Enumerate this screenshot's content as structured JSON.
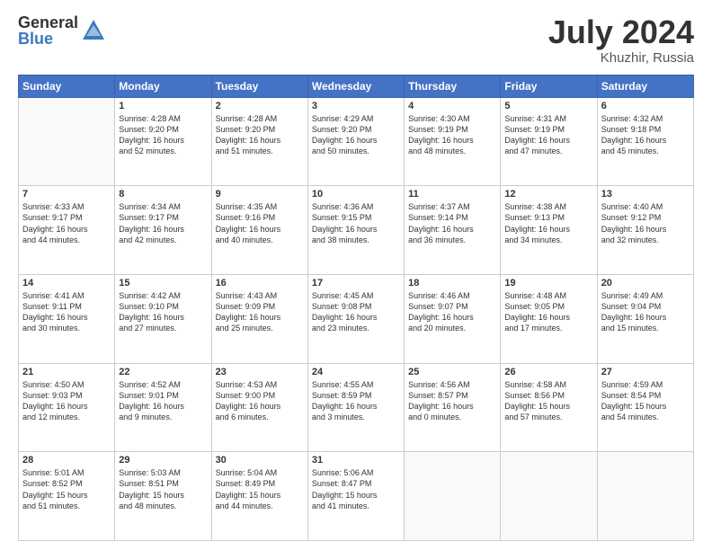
{
  "header": {
    "logo_general": "General",
    "logo_blue": "Blue",
    "title": "July 2024",
    "location": "Khuzhir, Russia"
  },
  "days_of_week": [
    "Sunday",
    "Monday",
    "Tuesday",
    "Wednesday",
    "Thursday",
    "Friday",
    "Saturday"
  ],
  "weeks": [
    [
      {
        "day": "",
        "info": ""
      },
      {
        "day": "1",
        "info": "Sunrise: 4:28 AM\nSunset: 9:20 PM\nDaylight: 16 hours\nand 52 minutes."
      },
      {
        "day": "2",
        "info": "Sunrise: 4:28 AM\nSunset: 9:20 PM\nDaylight: 16 hours\nand 51 minutes."
      },
      {
        "day": "3",
        "info": "Sunrise: 4:29 AM\nSunset: 9:20 PM\nDaylight: 16 hours\nand 50 minutes."
      },
      {
        "day": "4",
        "info": "Sunrise: 4:30 AM\nSunset: 9:19 PM\nDaylight: 16 hours\nand 48 minutes."
      },
      {
        "day": "5",
        "info": "Sunrise: 4:31 AM\nSunset: 9:19 PM\nDaylight: 16 hours\nand 47 minutes."
      },
      {
        "day": "6",
        "info": "Sunrise: 4:32 AM\nSunset: 9:18 PM\nDaylight: 16 hours\nand 45 minutes."
      }
    ],
    [
      {
        "day": "7",
        "info": "Sunrise: 4:33 AM\nSunset: 9:17 PM\nDaylight: 16 hours\nand 44 minutes."
      },
      {
        "day": "8",
        "info": "Sunrise: 4:34 AM\nSunset: 9:17 PM\nDaylight: 16 hours\nand 42 minutes."
      },
      {
        "day": "9",
        "info": "Sunrise: 4:35 AM\nSunset: 9:16 PM\nDaylight: 16 hours\nand 40 minutes."
      },
      {
        "day": "10",
        "info": "Sunrise: 4:36 AM\nSunset: 9:15 PM\nDaylight: 16 hours\nand 38 minutes."
      },
      {
        "day": "11",
        "info": "Sunrise: 4:37 AM\nSunset: 9:14 PM\nDaylight: 16 hours\nand 36 minutes."
      },
      {
        "day": "12",
        "info": "Sunrise: 4:38 AM\nSunset: 9:13 PM\nDaylight: 16 hours\nand 34 minutes."
      },
      {
        "day": "13",
        "info": "Sunrise: 4:40 AM\nSunset: 9:12 PM\nDaylight: 16 hours\nand 32 minutes."
      }
    ],
    [
      {
        "day": "14",
        "info": "Sunrise: 4:41 AM\nSunset: 9:11 PM\nDaylight: 16 hours\nand 30 minutes."
      },
      {
        "day": "15",
        "info": "Sunrise: 4:42 AM\nSunset: 9:10 PM\nDaylight: 16 hours\nand 27 minutes."
      },
      {
        "day": "16",
        "info": "Sunrise: 4:43 AM\nSunset: 9:09 PM\nDaylight: 16 hours\nand 25 minutes."
      },
      {
        "day": "17",
        "info": "Sunrise: 4:45 AM\nSunset: 9:08 PM\nDaylight: 16 hours\nand 23 minutes."
      },
      {
        "day": "18",
        "info": "Sunrise: 4:46 AM\nSunset: 9:07 PM\nDaylight: 16 hours\nand 20 minutes."
      },
      {
        "day": "19",
        "info": "Sunrise: 4:48 AM\nSunset: 9:05 PM\nDaylight: 16 hours\nand 17 minutes."
      },
      {
        "day": "20",
        "info": "Sunrise: 4:49 AM\nSunset: 9:04 PM\nDaylight: 16 hours\nand 15 minutes."
      }
    ],
    [
      {
        "day": "21",
        "info": "Sunrise: 4:50 AM\nSunset: 9:03 PM\nDaylight: 16 hours\nand 12 minutes."
      },
      {
        "day": "22",
        "info": "Sunrise: 4:52 AM\nSunset: 9:01 PM\nDaylight: 16 hours\nand 9 minutes."
      },
      {
        "day": "23",
        "info": "Sunrise: 4:53 AM\nSunset: 9:00 PM\nDaylight: 16 hours\nand 6 minutes."
      },
      {
        "day": "24",
        "info": "Sunrise: 4:55 AM\nSunset: 8:59 PM\nDaylight: 16 hours\nand 3 minutes."
      },
      {
        "day": "25",
        "info": "Sunrise: 4:56 AM\nSunset: 8:57 PM\nDaylight: 16 hours\nand 0 minutes."
      },
      {
        "day": "26",
        "info": "Sunrise: 4:58 AM\nSunset: 8:56 PM\nDaylight: 15 hours\nand 57 minutes."
      },
      {
        "day": "27",
        "info": "Sunrise: 4:59 AM\nSunset: 8:54 PM\nDaylight: 15 hours\nand 54 minutes."
      }
    ],
    [
      {
        "day": "28",
        "info": "Sunrise: 5:01 AM\nSunset: 8:52 PM\nDaylight: 15 hours\nand 51 minutes."
      },
      {
        "day": "29",
        "info": "Sunrise: 5:03 AM\nSunset: 8:51 PM\nDaylight: 15 hours\nand 48 minutes."
      },
      {
        "day": "30",
        "info": "Sunrise: 5:04 AM\nSunset: 8:49 PM\nDaylight: 15 hours\nand 44 minutes."
      },
      {
        "day": "31",
        "info": "Sunrise: 5:06 AM\nSunset: 8:47 PM\nDaylight: 15 hours\nand 41 minutes."
      },
      {
        "day": "",
        "info": ""
      },
      {
        "day": "",
        "info": ""
      },
      {
        "day": "",
        "info": ""
      }
    ]
  ]
}
